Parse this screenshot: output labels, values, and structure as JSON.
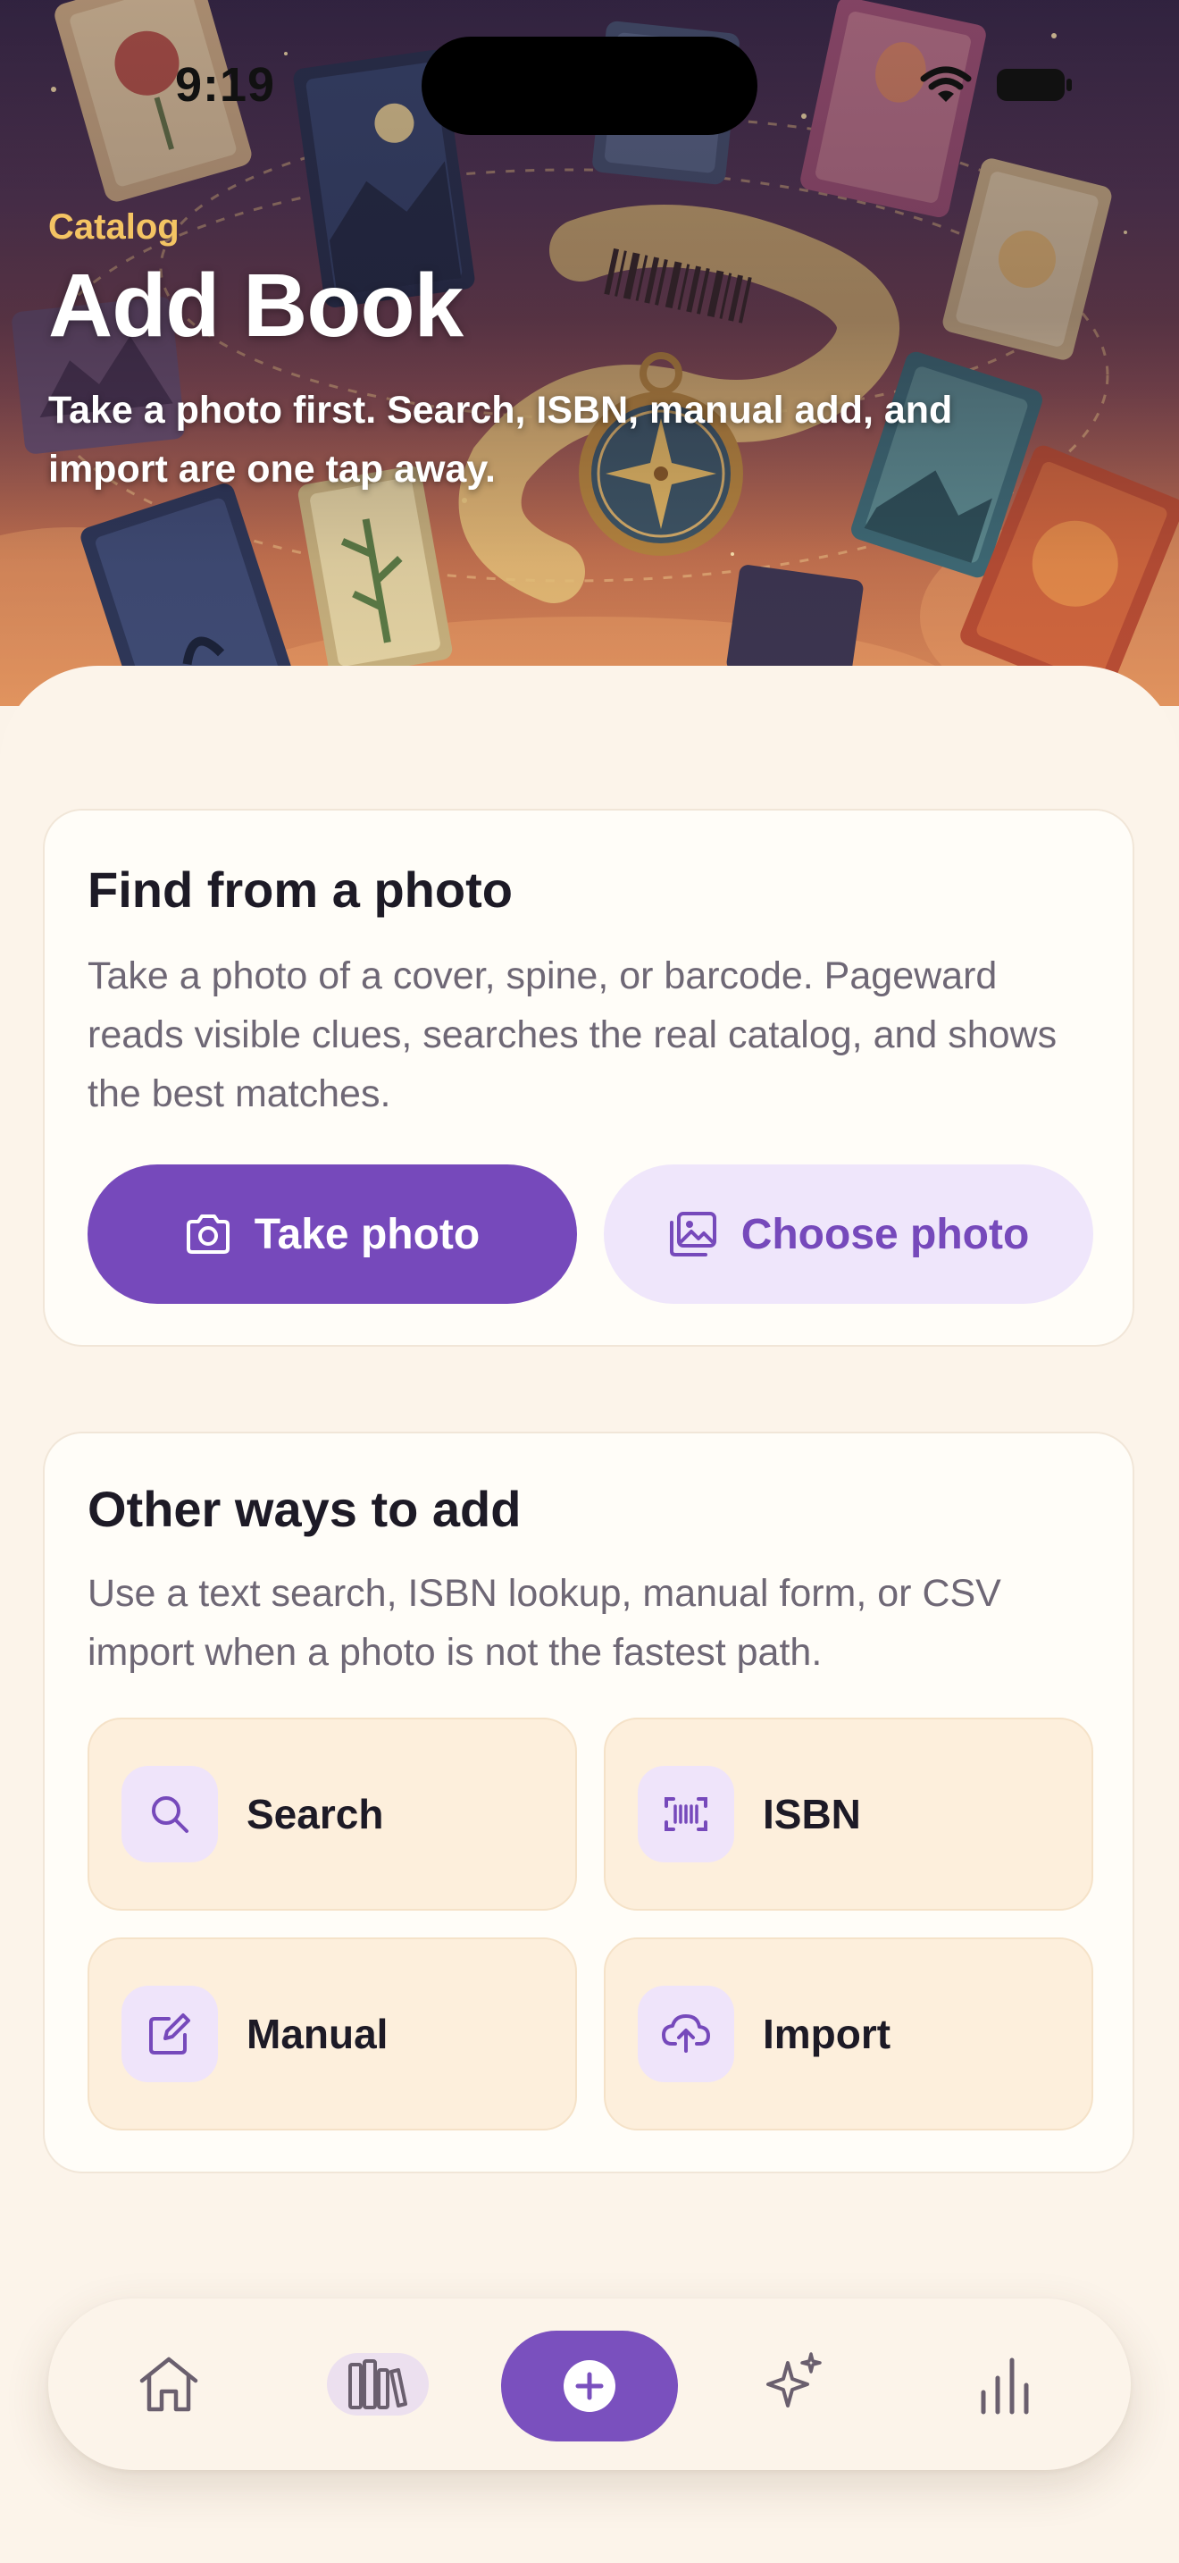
{
  "status_bar": {
    "time": "9:19",
    "icons": [
      "cellular-wifi-icon",
      "battery-icon"
    ]
  },
  "header": {
    "eyebrow": "Catalog",
    "title": "Add Book",
    "subtitle": "Take a photo first. Search, ISBN, manual add, and import are one tap away."
  },
  "photo_card": {
    "title": "Find from a photo",
    "description": "Take a photo of a cover, spine, or barcode. Pageward reads visible clues, searches the real catalog, and shows the best matches.",
    "take_photo_label": "Take photo",
    "choose_photo_label": "Choose photo"
  },
  "other_card": {
    "title": "Other ways to add",
    "description": "Use a text search, ISBN lookup, manual form, or CSV import when a photo is not the fastest path.",
    "options": [
      {
        "label": "Search",
        "icon": "search-icon"
      },
      {
        "label": "ISBN",
        "icon": "barcode-icon"
      },
      {
        "label": "Manual",
        "icon": "edit-icon"
      },
      {
        "label": "Import",
        "icon": "cloud-upload-icon"
      }
    ]
  },
  "tab_bar": {
    "tabs": [
      {
        "icon": "home-icon"
      },
      {
        "icon": "library-icon",
        "selected": true
      },
      {
        "icon": "add-icon"
      },
      {
        "icon": "sparkles-icon"
      },
      {
        "icon": "stats-icon"
      }
    ]
  },
  "colors": {
    "accent": "#7649bb",
    "accent_soft": "#efe6fb",
    "eyebrow": "#f4c463",
    "background": "#fcf4ea",
    "tile": "#fdefdc"
  }
}
